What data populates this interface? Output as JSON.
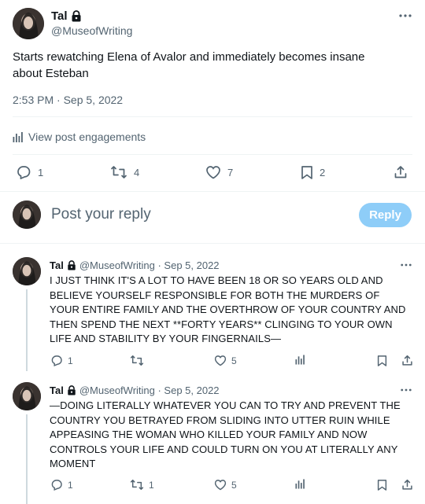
{
  "main_post": {
    "author_name": "Tal",
    "handle": "@MuseofWriting",
    "text": "Starts rewatching Elena of Avalor and immediately becomes insane about Esteban",
    "timestamp": "2:53 PM · Sep 5, 2022",
    "engagements_label": "View post engagements",
    "stats": {
      "replies": "1",
      "reposts": "4",
      "likes": "7",
      "bookmarks": "2"
    }
  },
  "composer": {
    "placeholder": "Post your reply",
    "reply_button": "Reply"
  },
  "replies": [
    {
      "author_name": "Tal",
      "handle_time": "@MuseofWriting · Sep 5, 2022",
      "text": "I JUST THINK IT'S A LOT TO HAVE BEEN 18 OR SO YEARS OLD AND BELIEVE YOURSELF RESPONSIBLE FOR BOTH THE MURDERS OF YOUR ENTIRE FAMILY AND THE OVERTHROW OF YOUR COUNTRY AND THEN SPEND THE NEXT **FORTY YEARS** CLINGING TO YOUR OWN LIFE AND STABILITY BY YOUR FINGERNAILS—",
      "replies": "1",
      "reposts": "",
      "likes": "5"
    },
    {
      "author_name": "Tal",
      "handle_time": "@MuseofWriting · Sep 5, 2022",
      "text": "—DOING LITERALLY WHATEVER YOU CAN TO TRY AND PREVENT THE COUNTRY YOU BETRAYED FROM SLIDING INTO UTTER RUIN WHILE APPEASING THE WOMAN WHO KILLED YOUR FAMILY AND NOW CONTROLS YOUR LIFE AND COULD TURN ON YOU AT LITERALLY ANY MOMENT",
      "replies": "1",
      "reposts": "1",
      "likes": "5"
    }
  ],
  "colors": {
    "accent_disabled": "#8ecdf8",
    "muted": "#536471",
    "divider": "#eff3f4"
  }
}
